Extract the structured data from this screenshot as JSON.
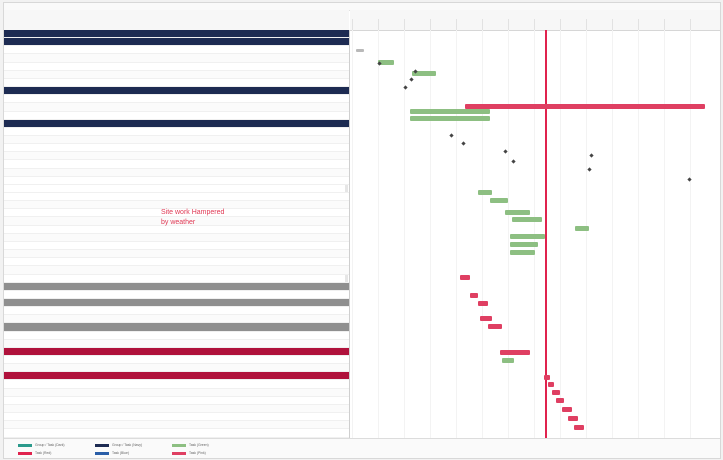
{
  "annotation_lines": [
    "Site work Hampered",
    "by weather"
  ],
  "legend": [
    {
      "label": "Group / Task (Dark)",
      "color": "#2b9a8c"
    },
    {
      "label": "Task (Red)",
      "color": "#e0234e"
    },
    {
      "label": "Group / Task (Navy)",
      "color": "#1d2b52"
    },
    {
      "label": "Task (Blue)",
      "color": "#2a5ea8"
    },
    {
      "label": "Task (Green)",
      "color": "#8dbf82"
    },
    {
      "label": "Task (Pink)",
      "color": "#df3f62"
    }
  ],
  "colors": {
    "today_line": "#e0234e",
    "navy": "#1d2b52",
    "gray": "#8f8f8f",
    "red": "#b0123c",
    "green": "#8dbf82",
    "pink": "#df3f62"
  }
}
